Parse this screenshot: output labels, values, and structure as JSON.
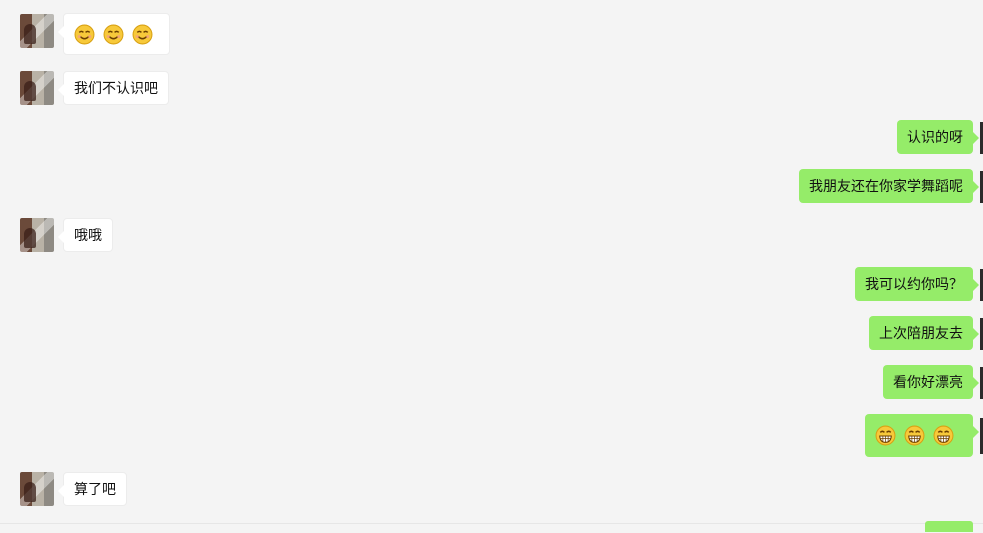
{
  "messages": [
    {
      "side": "in",
      "emoji": [
        "smile-icon",
        "smile-icon",
        "smile-icon"
      ]
    },
    {
      "side": "in",
      "text": "我们不认识吧"
    },
    {
      "side": "out",
      "text": "认识的呀"
    },
    {
      "side": "out",
      "text": "我朋友还在你家学舞蹈呢"
    },
    {
      "side": "in",
      "text": "哦哦"
    },
    {
      "side": "out",
      "text": "我可以约你吗？"
    },
    {
      "side": "out",
      "text": "上次陪朋友去"
    },
    {
      "side": "out",
      "text": "看你好漂亮"
    },
    {
      "side": "out",
      "emoji": [
        "grin-icon",
        "grin-icon",
        "grin-icon"
      ]
    },
    {
      "side": "in",
      "text": "算了吧"
    }
  ],
  "colors": {
    "background": "#f4f4f4",
    "incoming_bubble": "#ffffff",
    "outgoing_bubble": "#95ec69",
    "emoji": "#f4c21b"
  }
}
